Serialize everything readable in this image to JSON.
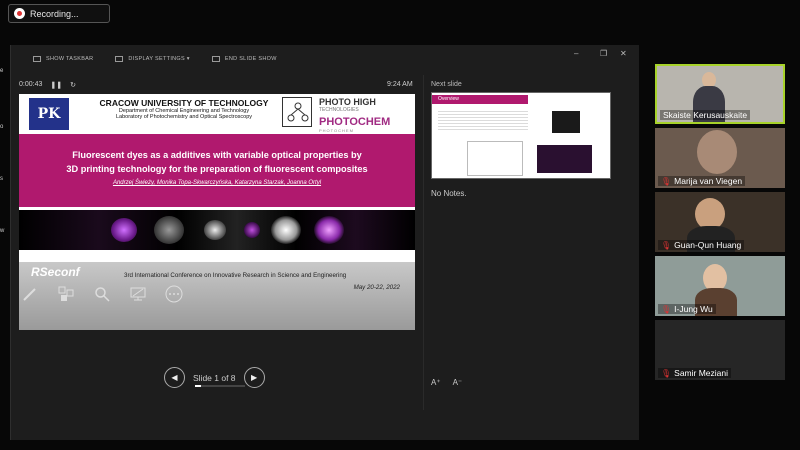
{
  "recording": {
    "label": "Recording..."
  },
  "toolbar": {
    "show_taskbar": "SHOW TASKBAR",
    "display_settings": "DISPLAY SETTINGS ▾",
    "end_slide_show": "END SLIDE SHOW"
  },
  "presenter": {
    "timer": "0:00:43",
    "clock": "9:24 AM",
    "slide_counter": "Slide 1 of 8",
    "progress_fraction": 0.125,
    "next_slide_label": "Next slide",
    "notes": "No Notes."
  },
  "slide": {
    "university": "CRACOW UNIVERSITY OF TECHNOLOGY",
    "department": "Department of Chemical Engineering and Technology",
    "laboratory": "Laboratory of Photochemistry and Optical Spectroscopy",
    "pk_logo": "PK",
    "photo_high": "PHOTO HIGH",
    "technologies": "TECHNOLOGIES",
    "photochem": "PHOTOCHEM",
    "photochem_sub": "PHOTOCHEM",
    "title_line1": "Fluorescent dyes as a additives with variable optical properties by",
    "title_line2": "3D printing technology for the preparation of fluorescent composites",
    "authors": "Andrzej Świeży, Monika Topa-Skwarczyńska, Katarzyna Starzak, Joanna Ortyl",
    "conference": "3rd International Conference on Innovative Research in Science and Engineering",
    "dates": "May 20-22, 2022",
    "conf_logo": "RSeconf"
  },
  "next_slide": {
    "heading": "Overview"
  },
  "font_controls": {
    "increase": "A⁺",
    "decrease": "A⁻"
  },
  "participants": [
    {
      "name": "Skaiste Kerusauskaite",
      "active": true,
      "muted": false
    },
    {
      "name": "Marija van Viegen",
      "active": false,
      "muted": true
    },
    {
      "name": "Guan-Qun Huang",
      "active": false,
      "muted": true
    },
    {
      "name": "I-Jung Wu",
      "active": false,
      "muted": true
    },
    {
      "name": "Samir Meziani",
      "active": false,
      "muted": true
    }
  ],
  "icons": {
    "prev": "◀",
    "next": "▶",
    "pause": "❚❚",
    "restart": "↻",
    "pen": "pen-icon",
    "grid": "grid-icon",
    "zoom": "zoom-icon",
    "screen": "screen-icon",
    "more": "more-icon"
  },
  "colors": {
    "accent_magenta": "#b0196e",
    "active_border": "#a7d22a",
    "mic_muted": "#dd3333"
  }
}
